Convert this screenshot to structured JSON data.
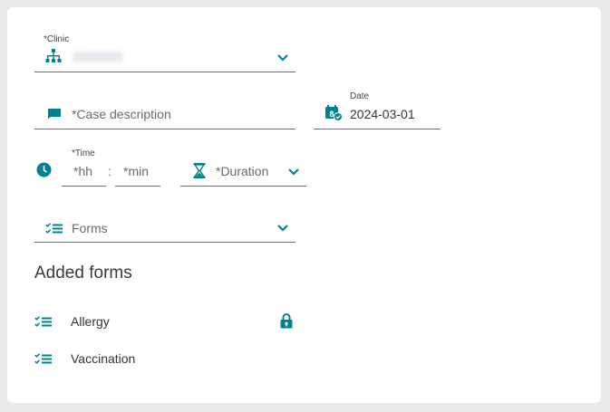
{
  "clinic": {
    "label": "*Clinic",
    "value": ""
  },
  "case_description": {
    "placeholder": "*Case description"
  },
  "date": {
    "label": "Date",
    "value": "2024-03-01"
  },
  "time": {
    "label": "*Time",
    "hh_placeholder": "*hh",
    "separator": ":",
    "min_placeholder": "*min"
  },
  "duration": {
    "placeholder": "*Duration"
  },
  "forms": {
    "placeholder": "Forms"
  },
  "added_forms": {
    "title": "Added forms",
    "items": [
      {
        "label": "Allergy",
        "locked": true
      },
      {
        "label": "Vaccination",
        "locked": false
      }
    ]
  },
  "colors": {
    "accent": "#00838f",
    "underline": "#6b6b6b"
  }
}
